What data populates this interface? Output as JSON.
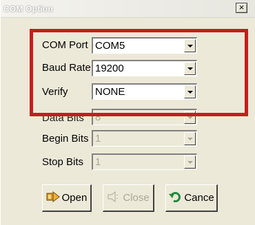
{
  "window": {
    "title": "COM Option",
    "close_glyph": "×"
  },
  "fields": {
    "com_port": {
      "label": "COM Port",
      "value": "COM5"
    },
    "baud_rate": {
      "label": "Baud Rate",
      "value": "19200"
    },
    "verify": {
      "label": "Verify",
      "value": "NONE"
    },
    "data_bits": {
      "label": "Data Bits",
      "value": "8"
    },
    "begin_bits": {
      "label": "Begin Bits",
      "value": "1"
    },
    "stop_bits": {
      "label": "Stop Bits",
      "value": "1"
    }
  },
  "buttons": {
    "open": {
      "label": "Open",
      "icon": "open-port-icon"
    },
    "close": {
      "label": "Close",
      "icon": "close-port-icon"
    },
    "cancel": {
      "label": "Cance",
      "icon": "cancel-arrow-icon"
    }
  },
  "colors": {
    "highlight": "#cc1a1a",
    "dialog_bg": "#ece9d8",
    "disabled_text": "#aca899"
  }
}
